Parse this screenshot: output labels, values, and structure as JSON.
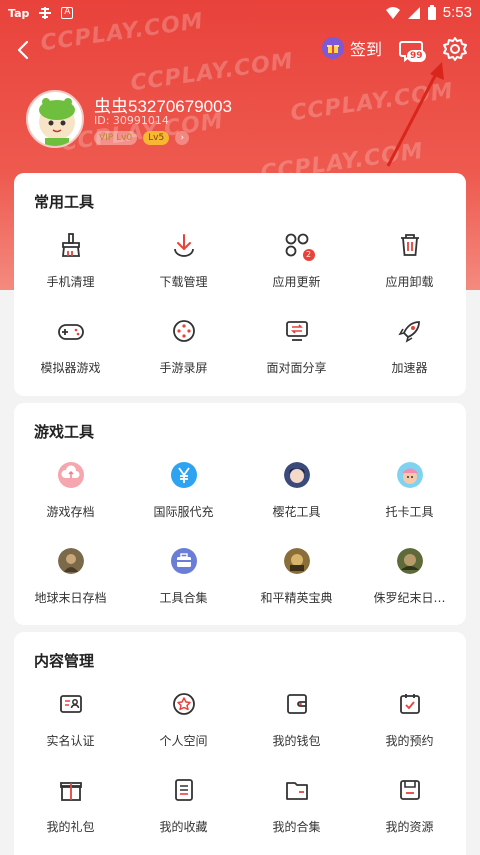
{
  "status_bar": {
    "tap_label": "Tap",
    "time": "5:53"
  },
  "header": {
    "checkin_label": "签到",
    "message_count": "99",
    "watermark": "CCPLAY.COM"
  },
  "profile": {
    "username": "虫虫53270679003",
    "uid": "ID: 30991014",
    "vip_level": "VIP Lv0",
    "level": "Lv5"
  },
  "sections": [
    {
      "title": "常用工具",
      "items": [
        {
          "label": "手机清理",
          "icon": "broom-icon"
        },
        {
          "label": "下载管理",
          "icon": "download-icon"
        },
        {
          "label": "应用更新",
          "icon": "apps-update-icon",
          "badge": "2"
        },
        {
          "label": "应用卸载",
          "icon": "trash-icon"
        },
        {
          "label": "模拟器游戏",
          "icon": "gamepad-icon"
        },
        {
          "label": "手游录屏",
          "icon": "screen-record-icon"
        },
        {
          "label": "面对面分享",
          "icon": "share-screen-icon"
        },
        {
          "label": "加速器",
          "icon": "rocket-icon"
        }
      ]
    },
    {
      "title": "游戏工具",
      "items": [
        {
          "label": "游戏存档",
          "icon": "cloud-save-icon"
        },
        {
          "label": "国际服代充",
          "icon": "yuan-icon"
        },
        {
          "label": "樱花工具",
          "icon": "sakura-game-avatar"
        },
        {
          "label": "托卡工具",
          "icon": "toca-game-avatar"
        },
        {
          "label": "地球末日存档",
          "icon": "earth-doom-game-avatar"
        },
        {
          "label": "工具合集",
          "icon": "toolbox-icon"
        },
        {
          "label": "和平精英宝典",
          "icon": "pubg-game-avatar"
        },
        {
          "label": "侏罗纪末日…",
          "icon": "jurassic-game-avatar"
        }
      ]
    },
    {
      "title": "内容管理",
      "items": [
        {
          "label": "实名认证",
          "icon": "id-card-icon"
        },
        {
          "label": "个人空间",
          "icon": "personal-space-icon"
        },
        {
          "label": "我的钱包",
          "icon": "wallet-icon"
        },
        {
          "label": "我的预约",
          "icon": "reservation-icon"
        },
        {
          "label": "我的礼包",
          "icon": "gift-pack-icon"
        },
        {
          "label": "我的收藏",
          "icon": "favorites-icon"
        },
        {
          "label": "我的合集",
          "icon": "collection-folder-icon"
        },
        {
          "label": "我的资源",
          "icon": "resources-icon"
        }
      ]
    }
  ],
  "colors": {
    "accent": "#e8423b",
    "header_bg": "#ee5a4f",
    "card_bg": "#ffffff",
    "page_bg": "#f3f3f3"
  }
}
